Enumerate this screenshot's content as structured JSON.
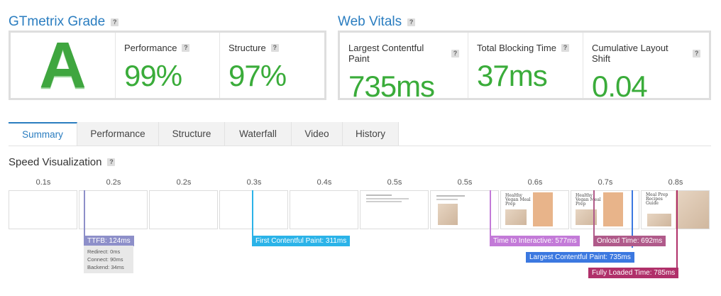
{
  "gtmetrix_grade": {
    "title": "GTmetrix Grade",
    "help": "?",
    "grade": "A",
    "performance": {
      "label": "Performance",
      "help": "?",
      "value": "99%"
    },
    "structure": {
      "label": "Structure",
      "help": "?",
      "value": "97%"
    }
  },
  "web_vitals": {
    "title": "Web Vitals",
    "help": "?",
    "lcp": {
      "label": "Largest Contentful Paint",
      "help": "?",
      "value": "735ms"
    },
    "tbt": {
      "label": "Total Blocking Time",
      "help": "?",
      "value": "37ms"
    },
    "cls": {
      "label": "Cumulative Layout Shift",
      "help": "?",
      "value": "0.04"
    }
  },
  "tabs": [
    {
      "label": "Summary",
      "active": true
    },
    {
      "label": "Performance"
    },
    {
      "label": "Structure"
    },
    {
      "label": "Waterfall"
    },
    {
      "label": "Video"
    },
    {
      "label": "History"
    }
  ],
  "speed_visualization": {
    "title": "Speed Visualization",
    "help": "?",
    "ticks": [
      "0.1s",
      "0.2s",
      "0.2s",
      "0.3s",
      "0.4s",
      "0.5s",
      "0.5s",
      "0.6s",
      "0.7s",
      "0.8s"
    ],
    "markers": {
      "ttfb": "TTFB: 124ms",
      "fcp": "First Contentful Paint: 311ms",
      "tti": "Time to Interactive: 577ms",
      "lcp": "Largest Contentful Paint: 735ms",
      "onload": "Onload Time: 692ms",
      "fully_loaded": "Fully Loaded Time: 785ms"
    },
    "ttfb_details": [
      "Redirect: 0ms",
      "Connect: 90ms",
      "Backend: 34ms"
    ],
    "frame_text": {
      "headline_a": "Healthy Vegan Meal Prep",
      "headline_b": "Meal Prep Recipes Guide"
    }
  },
  "colors": {
    "accent": "#2a7dc0",
    "good_green": "#3aac3a",
    "ttfb": "#8d8fc9",
    "fcp": "#2bb3e8",
    "tti": "#c37ad8",
    "lcp": "#3b78e0",
    "onload": "#b05a8a",
    "fully_loaded": "#b0306a"
  }
}
